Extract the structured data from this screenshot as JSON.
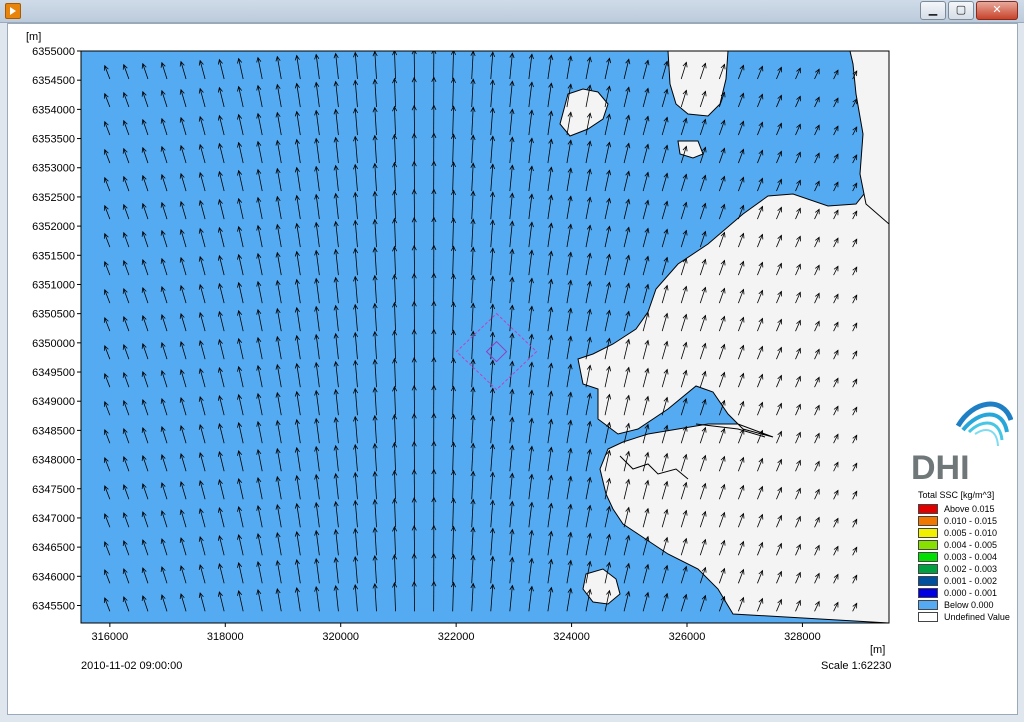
{
  "window": {
    "buttons": {
      "minimize": "▁",
      "maximize": "▢",
      "close": "✕"
    }
  },
  "map": {
    "y_unit": "[m]",
    "x_unit": "[m]",
    "timestamp": "2010-11-02 09:00:00",
    "scale": "Scale 1:62230",
    "water_color": "#55abf2",
    "land_color": "#f4f4f4",
    "chart_data": {
      "type": "map",
      "x": {
        "label": "[m]",
        "range": [
          315500,
          329500
        ],
        "ticks": [
          "316000",
          "318000",
          "320000",
          "322000",
          "324000",
          "326000",
          "328000"
        ]
      },
      "y": {
        "label": "[m]",
        "range": [
          6345200,
          6355000
        ],
        "ticks": [
          "6355000",
          "6354500",
          "6354000",
          "6353500",
          "6353000",
          "6352500",
          "6352000",
          "6351500",
          "6351000",
          "6350500",
          "6350000",
          "6349500",
          "6349000",
          "6348500",
          "6348000",
          "6347500",
          "6347000",
          "6346500",
          "6346000",
          "6345500"
        ]
      },
      "field": "current vectors (arrows)"
    }
  },
  "legend": {
    "title": "Total SSC [kg/m^3]",
    "items": [
      {
        "label": "Above  0.015",
        "color": "#e00000"
      },
      {
        "label": "0.010 - 0.015",
        "color": "#f07800"
      },
      {
        "label": "0.005 - 0.010",
        "color": "#f0f000"
      },
      {
        "label": "0.004 - 0.005",
        "color": "#88e000"
      },
      {
        "label": "0.003 - 0.004",
        "color": "#00e000"
      },
      {
        "label": "0.002 - 0.003",
        "color": "#00a040"
      },
      {
        "label": "0.001 - 0.002",
        "color": "#0050a0"
      },
      {
        "label": "0.000 - 0.001",
        "color": "#0000e0"
      },
      {
        "label": "Below  0.000",
        "color": "#55abf2"
      },
      {
        "label": "Undefined Value",
        "color": "#ffffff"
      }
    ]
  },
  "logo": {
    "text": "DHI"
  }
}
